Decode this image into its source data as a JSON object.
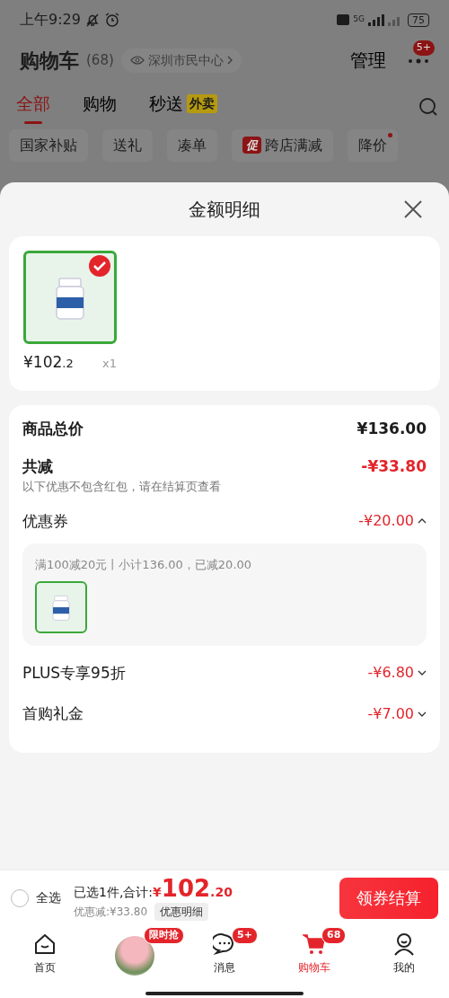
{
  "status_bar": {
    "time": "上午9:29",
    "network": "5G",
    "battery": "75"
  },
  "header": {
    "title": "购物车",
    "count": "(68)",
    "location": "深圳市民中心",
    "manage": "管理",
    "more_badge": "5+"
  },
  "tabs": [
    {
      "label": "全部",
      "selected": true
    },
    {
      "label": "购物",
      "selected": false
    },
    {
      "label": "秒送",
      "tag": "外卖",
      "selected": false
    }
  ],
  "chips": [
    {
      "label": "国家补贴",
      "dot": false
    },
    {
      "label": "送礼",
      "dot": false
    },
    {
      "label": "凑单",
      "dot": false
    },
    {
      "label": "跨店满减",
      "tag": "促",
      "dot": false
    },
    {
      "label": "降价",
      "dot": true
    }
  ],
  "sheet": {
    "title": "金额明细",
    "products": [
      {
        "price": "¥102",
        "price_decimal": ".2",
        "quantity": "x1",
        "selected": true
      }
    ],
    "total": {
      "label": "商品总价",
      "value": "¥136.00"
    },
    "reduction": {
      "label": "共减",
      "value": "-¥33.80",
      "note": "以下优惠不包含红包，请在结算页查看"
    },
    "discounts": [
      {
        "label": "优惠券",
        "value": "-¥20.00",
        "expanded": true,
        "detail": "满100减20元丨小计136.00，已减20.00"
      },
      {
        "label": "PLUS专享95折",
        "value": "-¥6.80",
        "expanded": false
      },
      {
        "label": "首购礼金",
        "value": "-¥7.00",
        "expanded": false
      }
    ]
  },
  "bottom_bar": {
    "select_all": {
      "label": "全选",
      "checked": false
    },
    "summary": "已选1件,合计:",
    "currency": "¥",
    "amount": "102",
    "amount_decimal": ".20",
    "discount": "优惠减:¥33.80",
    "details_button": "优惠明细",
    "checkout": "领券结算"
  },
  "nav": [
    {
      "kind": "home",
      "label": "首页",
      "selected": false
    },
    {
      "kind": "promo",
      "badge": "限时抢",
      "selected": false
    },
    {
      "kind": "message",
      "label": "消息",
      "badge": "5+",
      "selected": false
    },
    {
      "kind": "cart",
      "label": "购物车",
      "badge": "68",
      "selected": true
    },
    {
      "kind": "profile",
      "label": "我的",
      "selected": false
    }
  ]
}
